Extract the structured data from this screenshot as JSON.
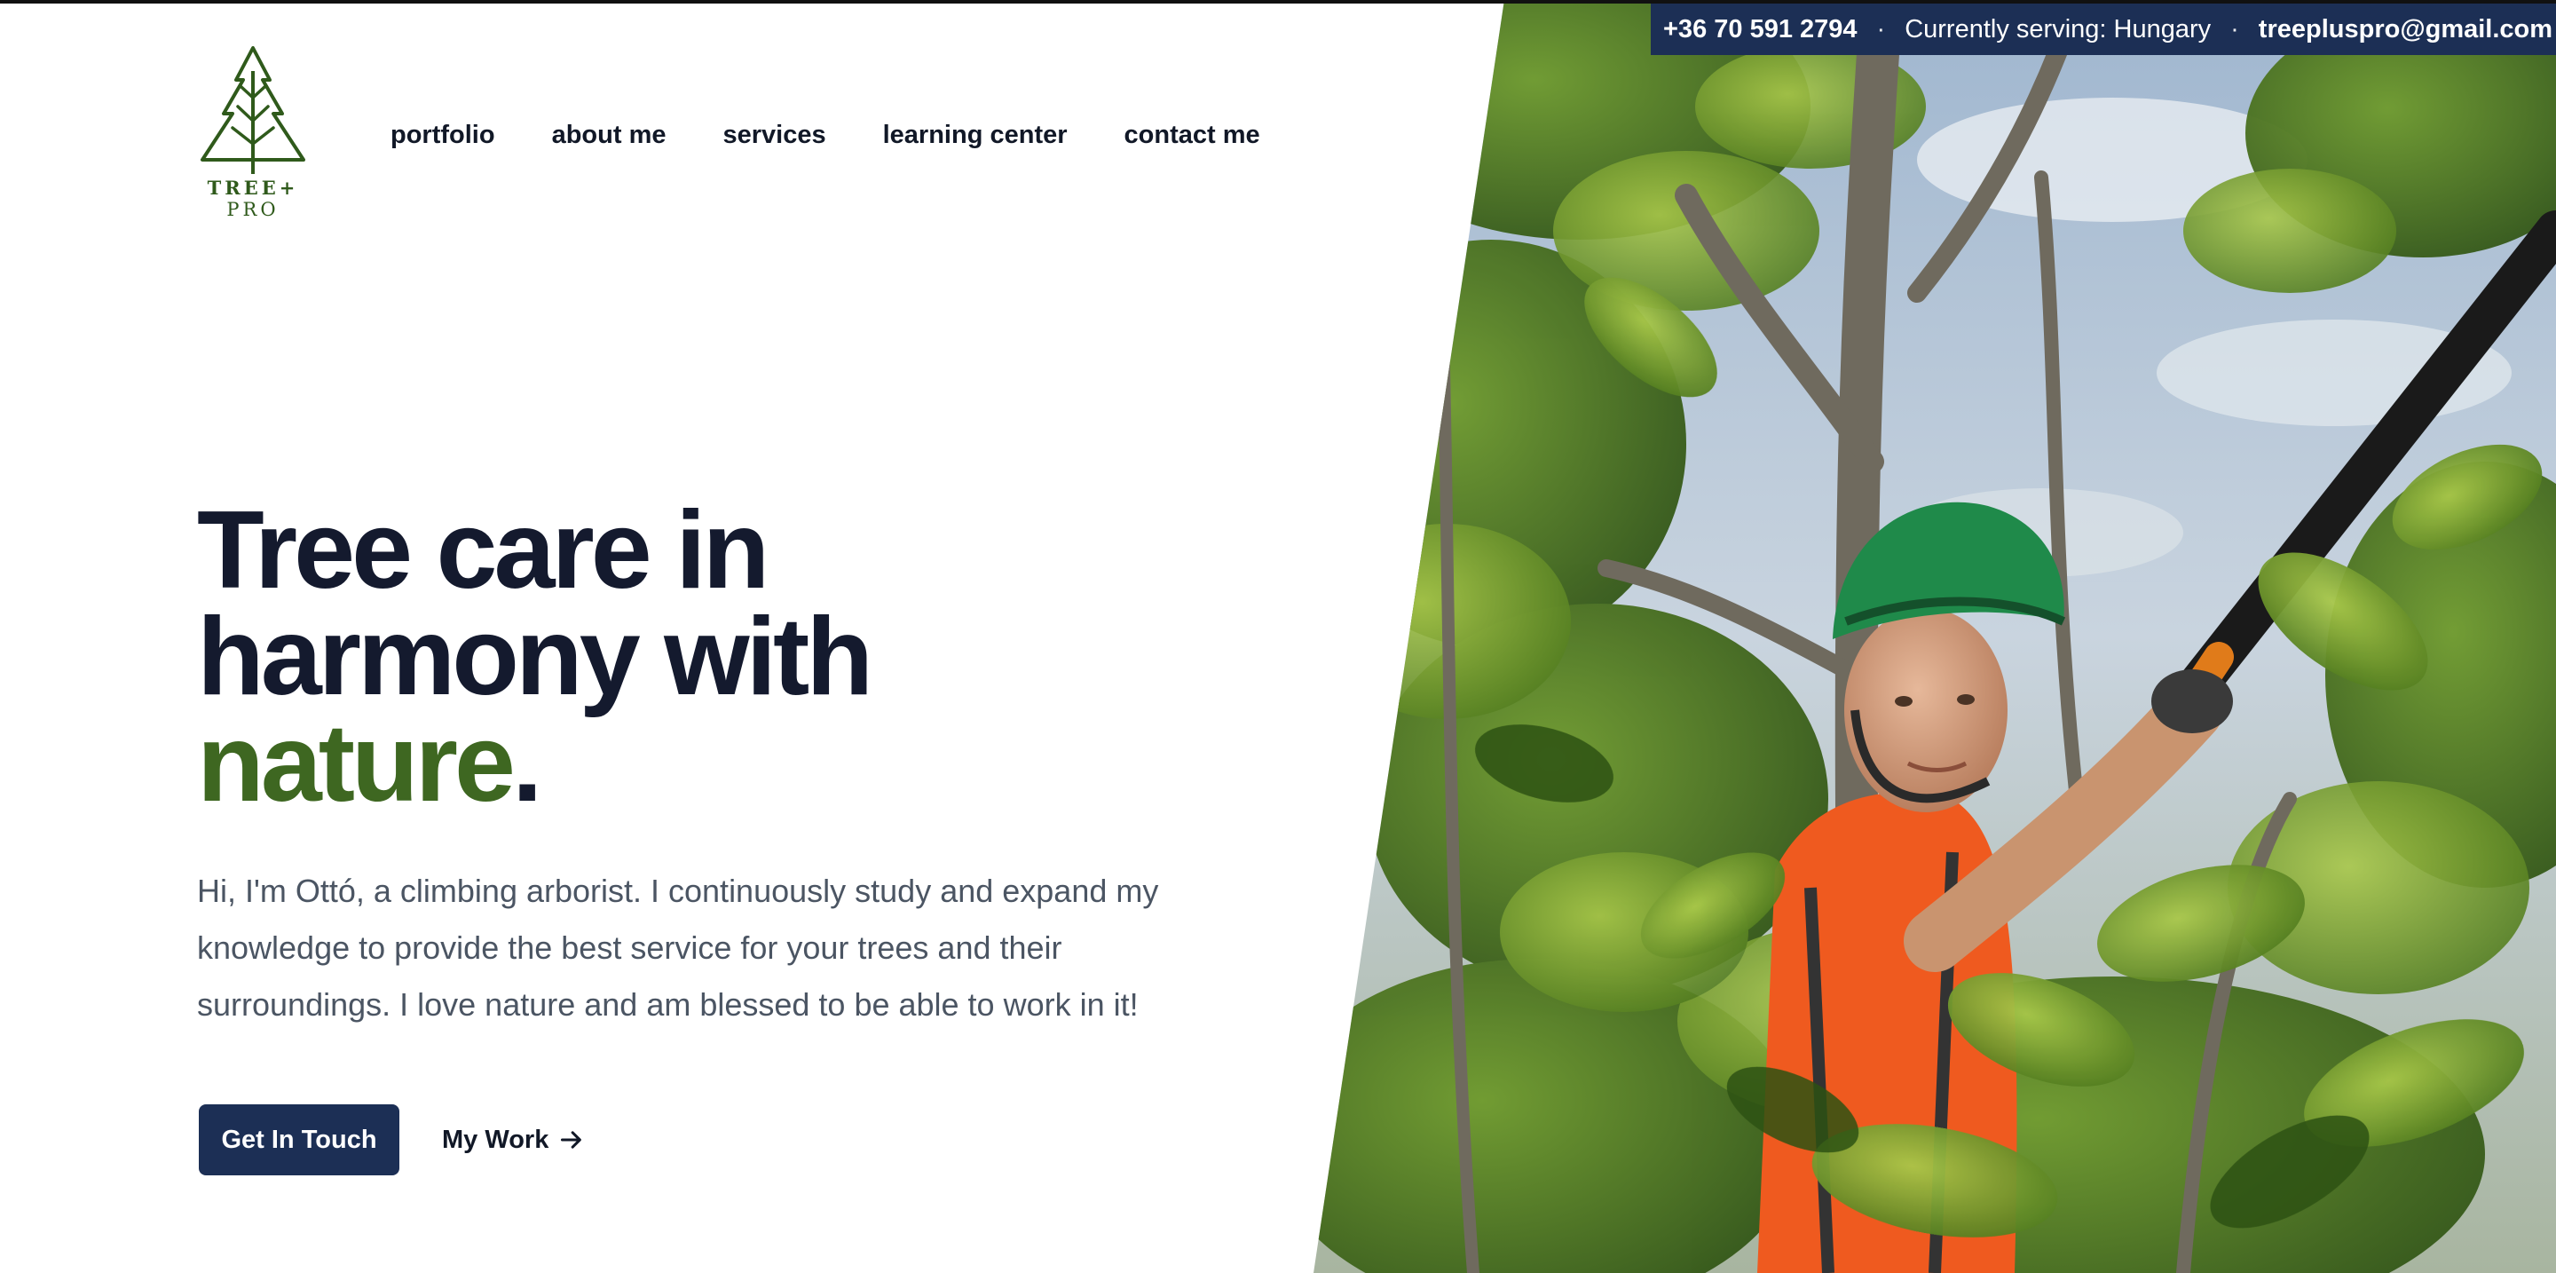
{
  "brand": {
    "logo_line1": "TREE+",
    "logo_line2": "PRO",
    "color": "#2f5a1b"
  },
  "contact_bar": {
    "phone": "+36 70 591 2794",
    "separator": "·",
    "serving": "Currently serving: Hungary",
    "email": "treepluspro@gmail.com",
    "background": "#1c2f55"
  },
  "nav": {
    "items": [
      {
        "label": "portfolio"
      },
      {
        "label": "about me"
      },
      {
        "label": "services"
      },
      {
        "label": "learning center"
      },
      {
        "label": "contact me"
      }
    ]
  },
  "hero": {
    "headline_line1": "Tree care in",
    "headline_line2": "harmony with",
    "headline_highlight": "nature",
    "headline_period": ".",
    "intro": "Hi, I'm Ottó, a climbing arborist. I continuously study and expand my knowledge to provide the best service for your trees and their surroundings. I love nature and am blessed to be able to work in it!",
    "primary_button": "Get In Touch",
    "secondary_button": "My Work",
    "secondary_icon": "arrow-right-icon",
    "highlight_color": "#3e6721",
    "headline_color": "#141a2e"
  },
  "photo": {
    "subject": "arborist-in-tree-photo"
  }
}
